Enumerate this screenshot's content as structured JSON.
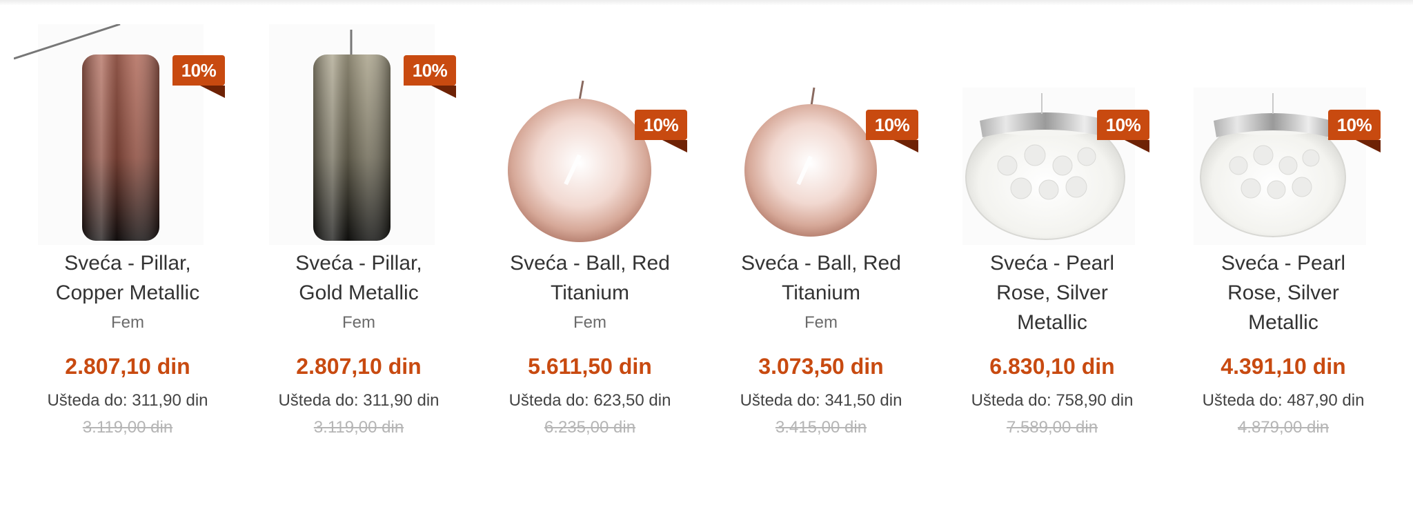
{
  "products": [
    {
      "title_line1": "Sveća - Pillar,",
      "title_line2": "Copper Metallic",
      "title_line3": "",
      "brand": "Fem",
      "badge": "10%",
      "price": "2.807,10 din",
      "saving": "Ušteda do: 311,90 din",
      "old_price": "3.119,00 din"
    },
    {
      "title_line1": "Sveća - Pillar,",
      "title_line2": "Gold Metallic",
      "title_line3": "",
      "brand": "Fem",
      "badge": "10%",
      "price": "2.807,10 din",
      "saving": "Ušteda do: 311,90 din",
      "old_price": "3.119,00 din"
    },
    {
      "title_line1": "Sveća - Ball, Red",
      "title_line2": "Titanium",
      "title_line3": "",
      "brand": "Fem",
      "badge": "10%",
      "price": "5.611,50 din",
      "saving": "Ušteda do: 623,50 din",
      "old_price": "6.235,00 din"
    },
    {
      "title_line1": "Sveća - Ball, Red",
      "title_line2": "Titanium",
      "title_line3": "",
      "brand": "Fem",
      "badge": "10%",
      "price": "3.073,50 din",
      "saving": "Ušteda do: 341,50 din",
      "old_price": "3.415,00 din"
    },
    {
      "title_line1": "Sveća - Pearl",
      "title_line2": "Rose, Silver",
      "title_line3": "Metallic",
      "brand": "",
      "badge": "10%",
      "price": "6.830,10 din",
      "saving": "Ušteda do: 758,90 din",
      "old_price": "7.589,00 din"
    },
    {
      "title_line1": "Sveća - Pearl",
      "title_line2": "Rose, Silver",
      "title_line3": "Metallic",
      "brand": "",
      "badge": "10%",
      "price": "4.391,10 din",
      "saving": "Ušteda do: 487,90 din",
      "old_price": "4.879,00 din"
    }
  ],
  "colors": {
    "accent": "#c84a10",
    "badge_fold": "#6e2205",
    "title": "#333333",
    "old_price": "#b5b5b5"
  }
}
